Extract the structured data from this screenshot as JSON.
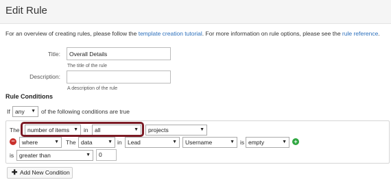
{
  "header": {
    "title": "Edit Rule"
  },
  "intro": {
    "text_before": "For an overview of creating rules, please follow the ",
    "link1": "template creation tutorial",
    "text_middle": ". For more information on rule options, please see the ",
    "link2": "rule reference",
    "text_after": "."
  },
  "form": {
    "title_label": "Title:",
    "title_value": "Overall Details",
    "title_help": "The title of the rule",
    "description_label": "Description:",
    "description_value": "",
    "description_help": "A description of the rule"
  },
  "rule_conditions": {
    "heading": "Rule Conditions",
    "if_label": "If",
    "match_select": "any",
    "match_suffix": "of the following conditions are true",
    "row1": {
      "the_label": "The",
      "aggregate_select": "number of items",
      "in_label": "in",
      "scope_select": "all",
      "collection_select": "projects"
    },
    "row2": {
      "where_select": "where",
      "the_label": "The",
      "data_select": "data",
      "in_label": "in",
      "source_select": "Lead",
      "field_select": "Username",
      "is_label": "is",
      "comparator_select": "empty"
    },
    "row3": {
      "is_label": "is",
      "operator_select": "greater than",
      "value": "0"
    },
    "add_button": "Add New Condition"
  },
  "colors": {
    "link": "#2a6ebb",
    "highlight": "#7b1a24",
    "remove": "#c9302c",
    "add": "#2da63f"
  }
}
